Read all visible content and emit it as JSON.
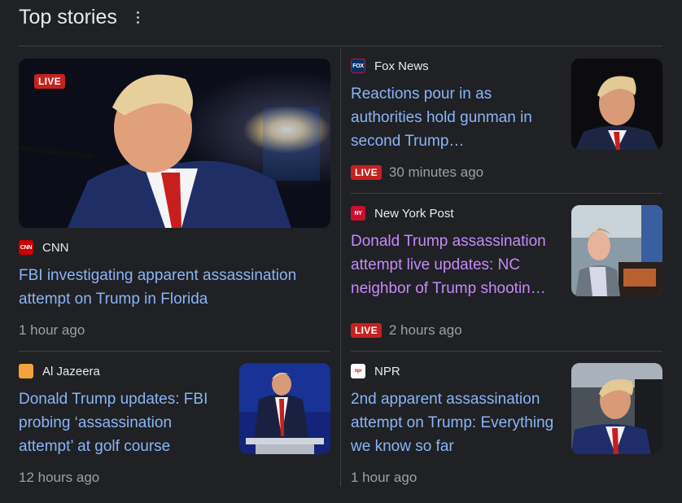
{
  "section": {
    "title": "Top stories",
    "menu_icon": "more-vert-icon"
  },
  "colors": {
    "link": "#8ab4f8",
    "visited": "#c58af9",
    "live": "#c5221f",
    "meta": "#9aa0a6",
    "background": "#202124"
  },
  "live_label": "LIVE",
  "stories": [
    {
      "source": "CNN",
      "favicon_text": "CNN",
      "headline": "FBI investigating apparent assassination attempt on Trump in Florida",
      "time": "1 hour ago",
      "live": true
    },
    {
      "source": "Fox News",
      "favicon_text": "FOX",
      "headline": "Reactions pour in as authorities hold gunman in second Trump…",
      "time": "30 minutes ago",
      "live": true
    },
    {
      "source": "New York Post",
      "favicon_text": "NY",
      "headline": "Donald Trump assassination attempt live updates: NC neighbor of Trump shootin…",
      "time": "2 hours ago",
      "live": true
    },
    {
      "source": "Al Jazeera",
      "favicon_text": "",
      "headline": "Donald Trump updates: FBI probing ‘assassination attempt’ at golf course",
      "time": "12 hours ago",
      "live": false
    },
    {
      "source": "NPR",
      "favicon_text": "npr",
      "headline": "2nd apparent assassination attempt on Trump: Everything we know so far",
      "time": "1 hour ago",
      "live": false
    }
  ]
}
